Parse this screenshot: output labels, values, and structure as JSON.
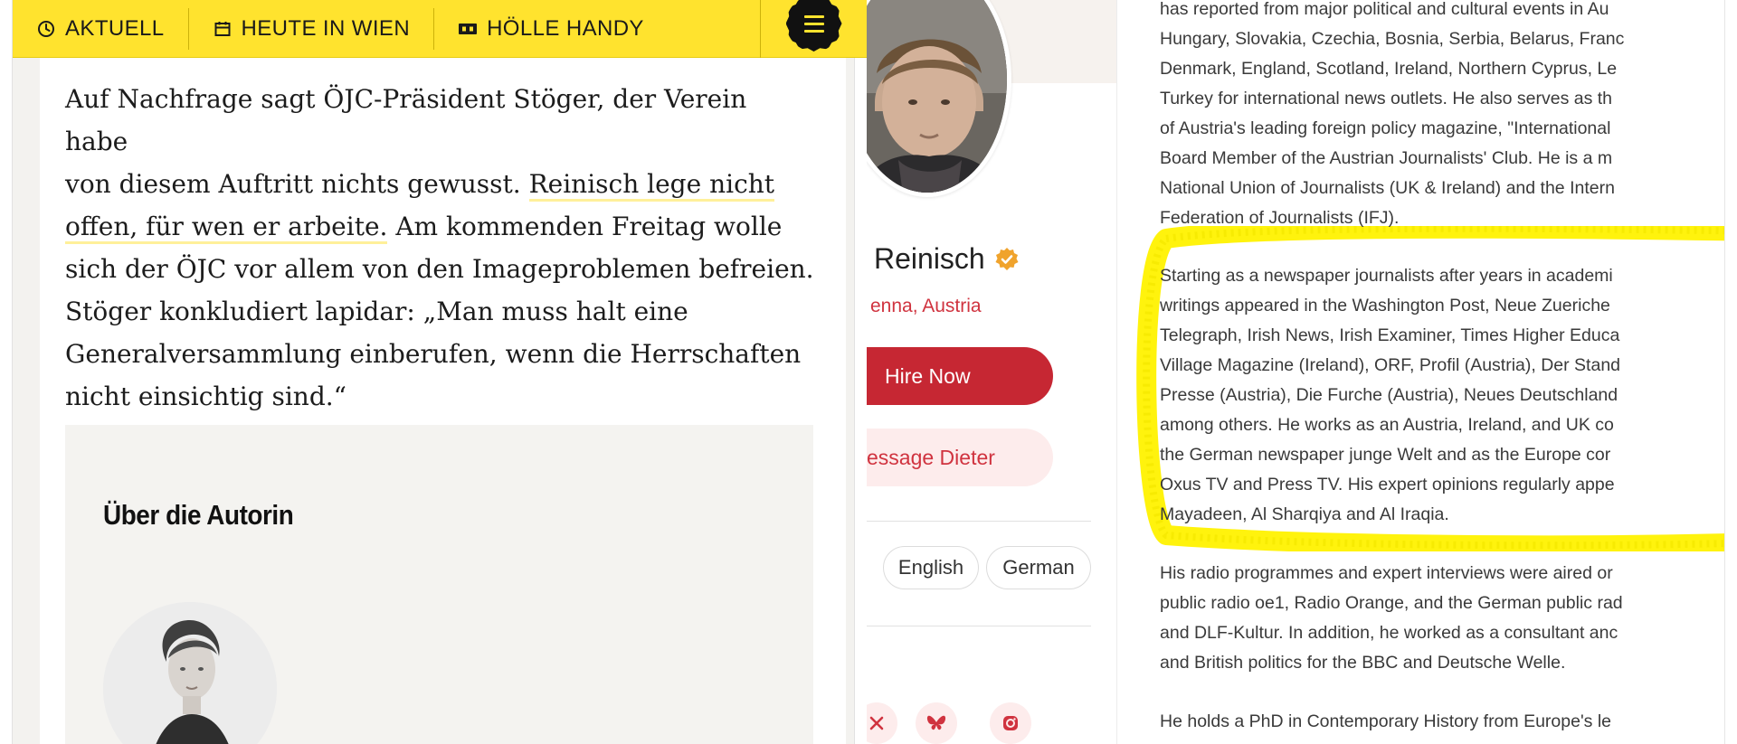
{
  "news": {
    "nav": [
      {
        "label": "AKTUELL",
        "icon": "clock-icon"
      },
      {
        "label": "HEUTE IN WIEN",
        "icon": "calendar-icon"
      },
      {
        "label": "HÖLLE HANDY",
        "icon": "ticket-icon"
      }
    ],
    "menu_icon": "hamburger-menu-icon",
    "accent_color": "#ffe32e",
    "article_lines": [
      [
        {
          "text": "Auf Nachfrage sagt ÖJC-Präsident Stöger, der Verein habe",
          "hl": false
        }
      ],
      [
        {
          "text": "von diesem Auftritt nichts gewusst. ",
          "hl": false
        },
        {
          "text": "Reinisch lege nicht",
          "hl": true
        }
      ],
      [
        {
          "text": "offen, für wen er arbeite.",
          "hl": true
        },
        {
          "text": " Am kommenden Freitag wolle",
          "hl": false
        }
      ],
      [
        {
          "text": "sich der ÖJC vor allem von den Imageproblemen befreien.",
          "hl": false
        }
      ],
      [
        {
          "text": "Stöger konkludiert lapidar: „Man muss halt eine",
          "hl": false
        }
      ],
      [
        {
          "text": "Generalversammlung einberufen, wenn die Herrschaften",
          "hl": false
        }
      ],
      [
        {
          "text": "nicht einsichtig sind.“",
          "hl": false
        }
      ]
    ],
    "author_heading": "Über die Autorin"
  },
  "profile": {
    "name": "Reinisch",
    "location": "enna, Austria",
    "hire_label": "Hire Now",
    "message_label": "essage Dieter",
    "languages": [
      "English",
      "German"
    ],
    "social_icons": [
      "x-icon",
      "bluesky-icon",
      "instagram-icon"
    ],
    "accent_color": "#c62733"
  },
  "bio": {
    "para1": [
      "has reported from major political and cultural events in Au",
      "Hungary, Slovakia, Czechia, Bosnia, Serbia, Belarus, Franc",
      "Denmark, England, Scotland, Ireland, Northern Cyprus, Le",
      "Turkey for international news outlets. He also serves as th",
      "of Austria's leading foreign policy magazine, \"International",
      "Board Member of the Austrian Journalists' Club. He is a m",
      "National Union of Journalists (UK & Ireland) and the Intern",
      "Federation of Journalists (IFJ)."
    ],
    "para2": [
      "Starting as a newspaper journalists after years in academi",
      "writings appeared in the Washington Post, Neue Zueriche",
      "Telegraph, Irish News, Irish Examiner, Times Higher Educa",
      "Village Magazine (Ireland), ORF, Profil (Austria), Der Stand",
      "Presse (Austria), Die Furche (Austria), Neues Deutschland",
      "among others. He works as an Austria, Ireland, and UK co",
      "the German newspaper junge Welt and as the Europe cor",
      "Oxus TV and Press TV. His expert opinions regularly appe",
      "Mayadeen, Al Sharqiya and Al Iraqia."
    ],
    "para3": [
      "His radio programmes and expert interviews were aired or",
      "public radio oe1, Radio Orange, and the German public rad",
      "and DLF-Kultur. In addition, he worked as a consultant anc",
      "and British politics for the BBC and Deutsche Welle."
    ],
    "para4": [
      "He holds a PhD in Contemporary History from Europe's le"
    ],
    "highlight_color": "#fff200"
  }
}
